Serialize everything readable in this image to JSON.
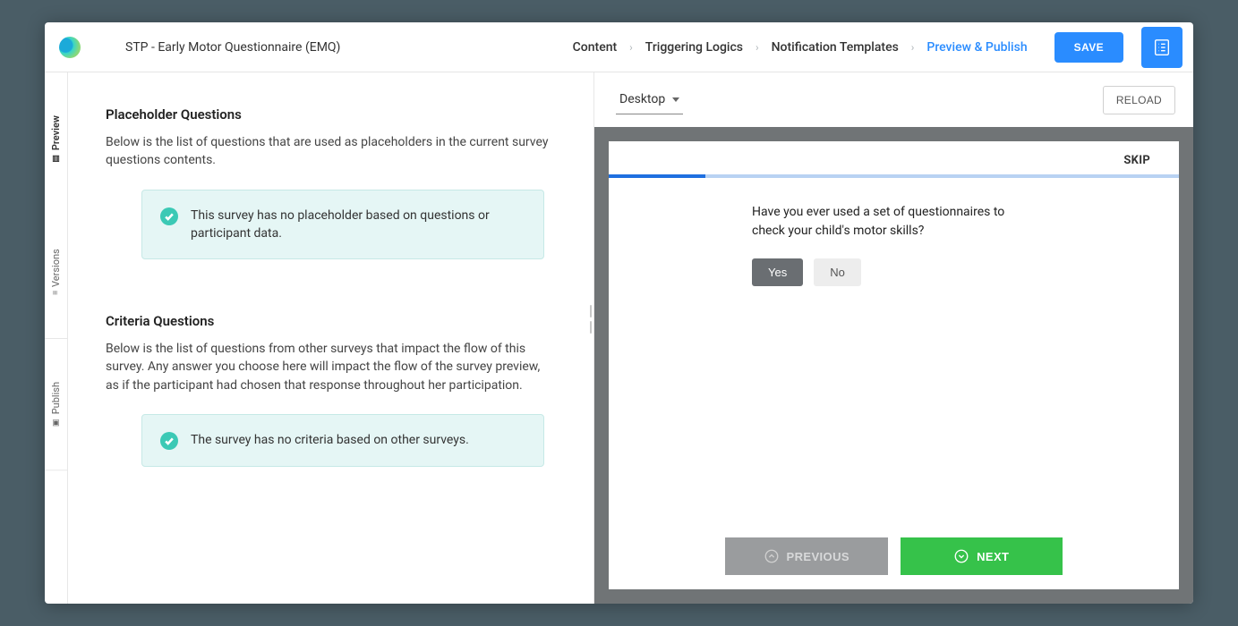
{
  "topbar": {
    "title": "STP - Early Motor Questionnaire (EMQ)",
    "nav": {
      "content": "Content",
      "logics": "Triggering Logics",
      "templates": "Notification Templates",
      "preview": "Preview & Publish"
    },
    "save": "SAVE"
  },
  "rail": {
    "preview": "Preview",
    "versions": "Versions",
    "publish": "Publish"
  },
  "left": {
    "placeholder": {
      "title": "Placeholder Questions",
      "desc": "Below is the list of questions that are used as placeholders in the current survey questions contents.",
      "info": "This survey has no placeholder based on questions or participant data."
    },
    "criteria": {
      "title": "Criteria Questions",
      "desc": "Below is the list of questions from other surveys that impact the flow of this survey. Any answer you choose here will impact the flow of the survey preview, as if the participant had chosen that response throughout her participation.",
      "info": "The survey has no criteria based on other surveys."
    }
  },
  "preview": {
    "device": "Desktop",
    "reload": "RELOAD",
    "skip": "SKIP",
    "question": "Have you ever used a set of questionnaires to check your child's motor skills?",
    "answers": {
      "yes": "Yes",
      "no": "No"
    },
    "previous": "PREVIOUS",
    "next": "NEXT"
  }
}
